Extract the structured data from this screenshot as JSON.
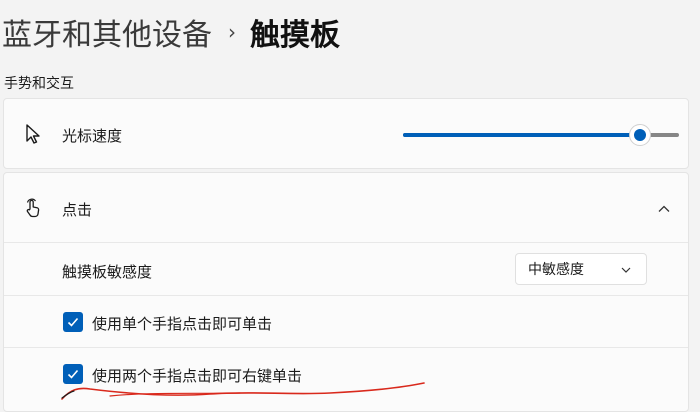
{
  "breadcrumb": {
    "parent": "蓝牙和其他设备",
    "separator": "›",
    "current": "触摸板"
  },
  "section_title": "手势和交互",
  "pointer_speed": {
    "label": "光标速度",
    "icon": "mouse-pointer-icon",
    "level_fraction": 0.86
  },
  "tap": {
    "label": "点击",
    "icon": "tap-hand-icon",
    "expanded": true,
    "sensitivity": {
      "label": "触摸板敏感度",
      "selected": "中敏感度"
    },
    "options": [
      {
        "label": "使用单个手指点击即可单击",
        "checked": true
      },
      {
        "label": "使用两个手指点击即可右键单击",
        "checked": true
      }
    ]
  },
  "colors": {
    "accent": "#005fb8",
    "background": "#f3f3f3",
    "card": "#fbfbfb",
    "annotation": "#d9291c"
  }
}
